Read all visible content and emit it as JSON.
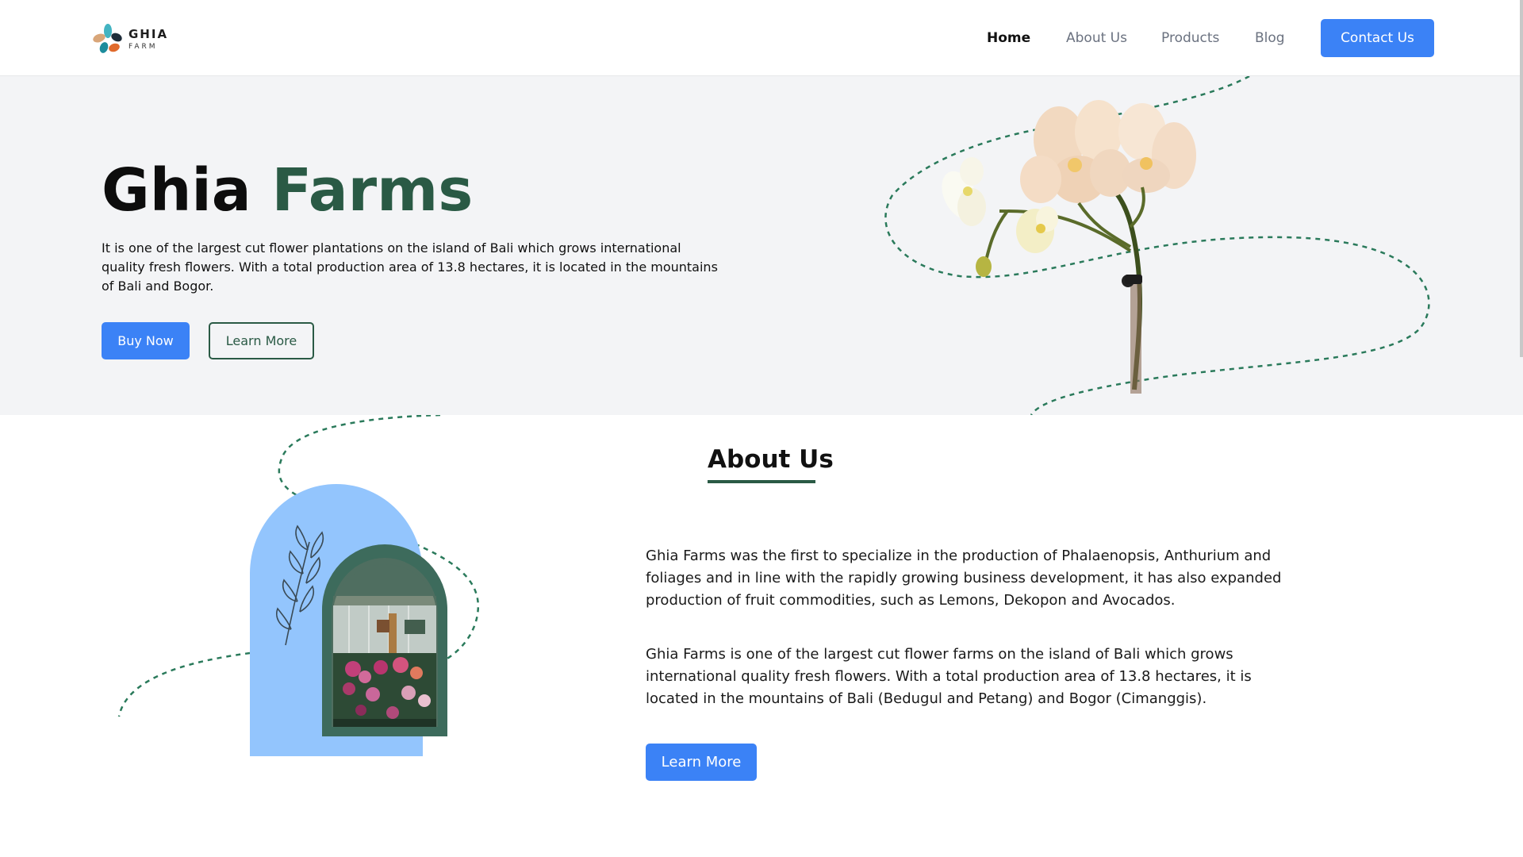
{
  "brand": {
    "name": "GHIA",
    "sub": "FARM",
    "colors": {
      "petal1": "#d9a679",
      "petal2": "#1c8c9c",
      "petal3": "#e06a2c",
      "petal4": "#1f2d3a",
      "petal5": "#43b4c2"
    }
  },
  "nav": {
    "items": [
      {
        "label": "Home",
        "active": true
      },
      {
        "label": "About Us",
        "active": false
      },
      {
        "label": "Products",
        "active": false
      },
      {
        "label": "Blog",
        "active": false
      }
    ],
    "contact_label": "Contact Us"
  },
  "hero": {
    "title_part1": "Ghia",
    "title_part2": "Farms",
    "description": "It is one of the largest cut flower plantations on the island of Bali which grows international quality fresh flowers. With a total production area of 13.8 hectares, it is located in the mountains of Bali and Bogor.",
    "buy_label": "Buy Now",
    "learn_label": "Learn More",
    "image_icon": "orchid-flower-image"
  },
  "about": {
    "heading": "About Us",
    "paragraph1": "Ghia Farms was the first to specialize in the production of Phalaenopsis, Anthurium and foliages and in line with the rapidly growing business development, it has also expanded production of fruit commodities, such as Lemons, Dekopon and Avocados.",
    "paragraph2": "Ghia Farms is one of the largest cut flower farms on the island of Bali which grows international quality fresh flowers. With a total production area of 13.8 hectares, it is located in the mountains of Bali (Bedugul and Petang) and Bogor (Cimanggis).",
    "learn_label": "Learn More",
    "image_icon": "greenhouse-photo"
  },
  "theme": {
    "accent_blue": "#3b82f6",
    "accent_green": "#2a5a45",
    "hero_bg": "#f3f4f6",
    "arch_blue": "#93c5fd"
  }
}
